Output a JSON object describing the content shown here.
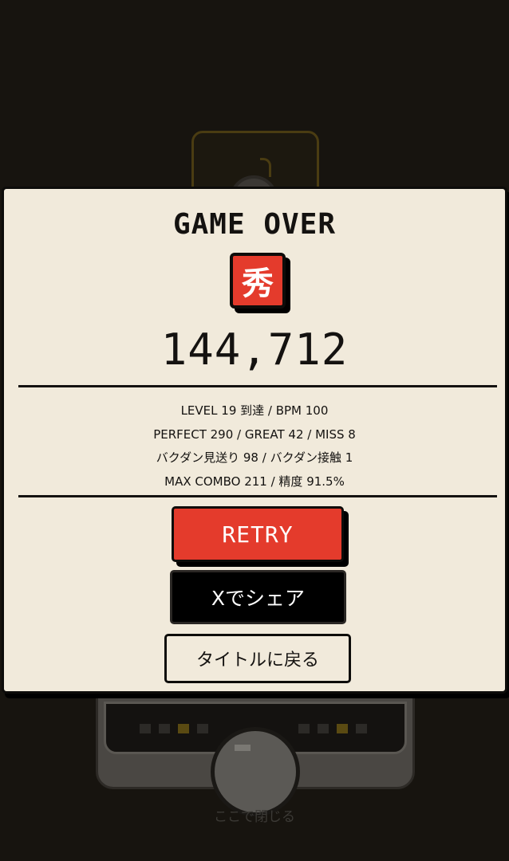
{
  "result": {
    "title": "GAME OVER",
    "grade": "秀",
    "score": "144,712"
  },
  "stats": [
    "LEVEL 19 到達 / BPM 100",
    "PERFECT 290 / GREAT 42 / MISS 8",
    "バクダン見送り 98 / バクダン接触 1",
    "MAX COMBO 211 / 精度 91.5%"
  ],
  "buttons": {
    "retry": "RETRY",
    "share": "Xでシェア",
    "back_to_title": "タイトルに戻る"
  },
  "background": {
    "close_hint": "ここで閉じる"
  },
  "colors": {
    "accent_red": "#e43b2c",
    "panel": "#f1eadb",
    "ink": "#141210",
    "backdrop": "#17140f"
  }
}
